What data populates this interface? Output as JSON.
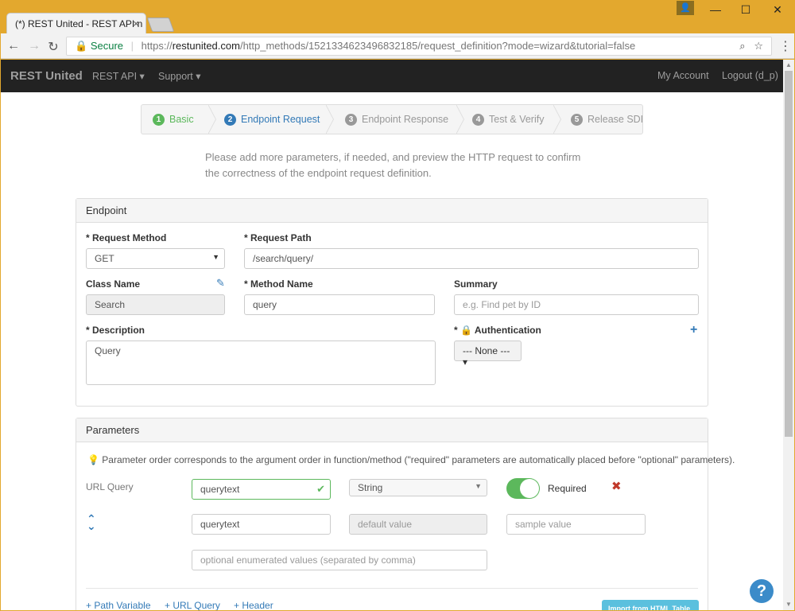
{
  "browser": {
    "tab_title": "(*) REST United - REST API n",
    "tab_close": "×",
    "controls": {
      "user": "👤",
      "minimize": "—",
      "maximize": "☐",
      "close": "✕"
    },
    "nav": {
      "back": "←",
      "forward": "→",
      "reload": "↻"
    },
    "secure_label": "Secure",
    "url_scheme": "https://",
    "url_host": "restunited.com",
    "url_path": "/http_methods/1521334623496832185/request_definition?mode=wizard&tutorial=false",
    "zoom_icon": "⌕",
    "star_icon": "☆",
    "menu_icon": "⋮"
  },
  "navbar": {
    "brand": "REST United",
    "items": [
      "REST API ▾",
      "Support ▾"
    ],
    "right": [
      "My Account",
      "Logout (d_p)"
    ]
  },
  "wizard": {
    "steps": [
      {
        "num": "1",
        "label": "Basic"
      },
      {
        "num": "2",
        "label": "Endpoint Request"
      },
      {
        "num": "3",
        "label": "Endpoint Response"
      },
      {
        "num": "4",
        "label": "Test & Verify"
      },
      {
        "num": "5",
        "label": "Release SDK"
      }
    ]
  },
  "intro": "Please add more parameters, if needed, and preview the HTTP request to confirm the correctness of the endpoint request definition.",
  "endpoint": {
    "heading": "Endpoint",
    "request_method_label": "* Request Method",
    "request_method_value": "GET",
    "request_path_label": "* Request Path",
    "request_path_value": "/search/query/",
    "class_name_label": "Class Name",
    "class_name_value": "Search",
    "method_name_label": "* Method Name",
    "method_name_value": "query",
    "summary_label": "Summary",
    "summary_placeholder": "e.g. Find pet by ID",
    "description_label": "* Description",
    "description_value": "Query",
    "auth_label": "* 🔒 Authentication",
    "auth_value": "--- None --- ▾",
    "edit_icon": "✎",
    "plus_icon": "+"
  },
  "parameters": {
    "heading": "Parameters",
    "hint": "💡 Parameter order corresponds to the argument order in function/method (\"required\" parameters are automatically placed before \"optional\" parameters).",
    "row_label": "URL Query",
    "name_value": "querytext",
    "check_icon": "✔",
    "type_value": "String",
    "required_label": "Required",
    "remove_icon": "✖",
    "up_icon": "⌃",
    "down_icon": "⌄",
    "description_value": "querytext",
    "default_placeholder": "default value",
    "sample_placeholder": "sample value",
    "enum_placeholder": "optional enumerated values (separated by comma)",
    "add_links": [
      "+ Path Variable",
      "+ URL Query",
      "+ Header"
    ],
    "import_button": "Import from HTML Table",
    "help": "?"
  },
  "colors": {
    "navbar": "#222222",
    "step_done": "#5cb85c",
    "step_active": "#337ab7",
    "step_todo": "#999999",
    "toggle_on": "#5cb85c",
    "frame": "#e3a82e"
  }
}
